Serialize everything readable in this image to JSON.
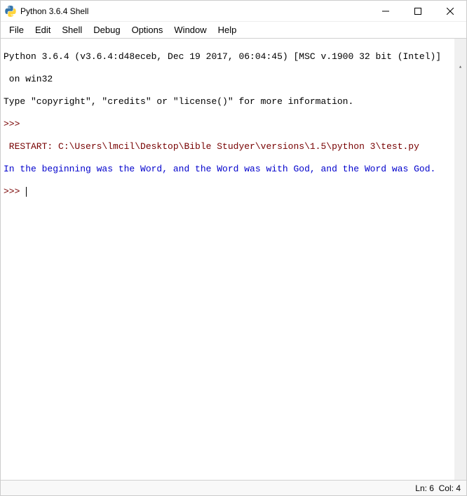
{
  "window": {
    "title": "Python 3.6.4 Shell"
  },
  "menubar": {
    "items": [
      "File",
      "Edit",
      "Shell",
      "Debug",
      "Options",
      "Window",
      "Help"
    ]
  },
  "console": {
    "line1": "Python 3.6.4 (v3.6.4:d48eceb, Dec 19 2017, 06:04:45) [MSC v.1900 32 bit (Intel)]",
    "line2": " on win32",
    "line3": "Type \"copyright\", \"credits\" or \"license()\" for more information.",
    "prompt": ">>> ",
    "restart": " RESTART: C:\\Users\\lmcil\\Desktop\\Bible Studyer\\versions\\1.5\\python 3\\test.py ",
    "output": "In the beginning was the Word, and the Word was with God, and the Word was God."
  },
  "statusbar": {
    "ln": "Ln: 6",
    "col": "Col: 4"
  }
}
